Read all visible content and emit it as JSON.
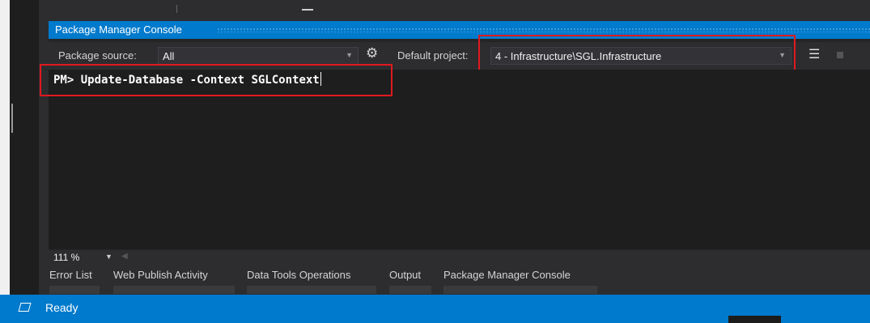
{
  "panel": {
    "title": "Package Manager Console"
  },
  "toolbar": {
    "package_source_label": "Package source:",
    "package_source_value": "All",
    "default_project_label": "Default project:",
    "default_project_value": "4 - Infrastructure\\SGL.Infrastructure"
  },
  "console": {
    "prompt": "PM>",
    "command": "Update-Database -Context SGLContext"
  },
  "zoom": {
    "level": "111 %"
  },
  "tabs": [
    {
      "label": "Error List"
    },
    {
      "label": "Web Publish Activity"
    },
    {
      "label": "Data Tools Operations"
    },
    {
      "label": "Output"
    },
    {
      "label": "Package Manager Console"
    }
  ],
  "status": {
    "text": "Ready"
  },
  "colors": {
    "accent": "#007acc",
    "highlight": "#e0191f",
    "console_bg": "#1e1e1e"
  },
  "icons": [
    "settings-gear-icon",
    "clear-console-icon",
    "stop-icon",
    "chevron-down-icon",
    "status-window-icon"
  ]
}
